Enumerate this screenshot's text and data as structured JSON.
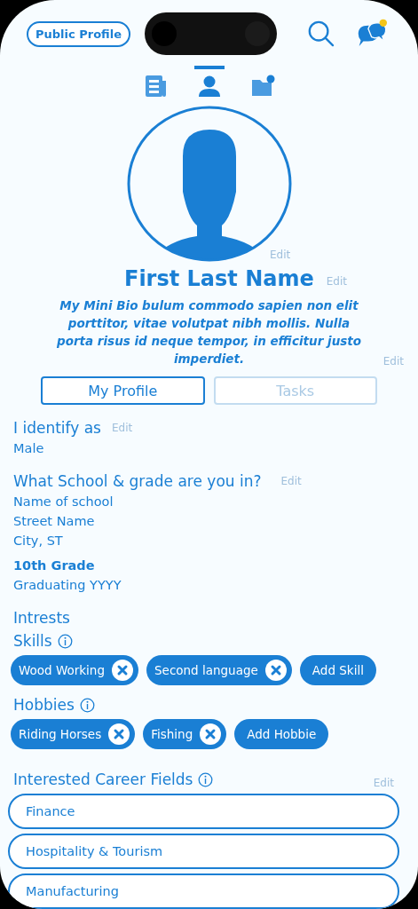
{
  "header": {
    "public_profile_button": "Public Profile",
    "notification_dot": true
  },
  "nav_tabs": [
    {
      "kind": "news",
      "selected": false
    },
    {
      "kind": "profile",
      "selected": true
    },
    {
      "kind": "folder",
      "selected": false
    }
  ],
  "avatar": {
    "edit": "Edit"
  },
  "name": {
    "text": "First Last Name",
    "edit": "Edit"
  },
  "bio": {
    "text": "My Mini Bio bulum commodo sapien non elit porttitor, vitae volutpat nibh mollis. Nulla porta risus id neque tempor, in efficitur justo imperdiet.",
    "edit": "Edit"
  },
  "profile_tabs": [
    {
      "label": "My Profile",
      "selected": true
    },
    {
      "label": "Tasks",
      "selected": false
    }
  ],
  "identity": {
    "title": "I identify as",
    "edit": "Edit",
    "value": "Male"
  },
  "school": {
    "title": "What School & grade are you in?",
    "edit": "Edit",
    "lines": [
      "Name of school",
      "Street Name",
      "City, ST"
    ],
    "grade": "10th Grade",
    "graduating": "Graduating YYYY"
  },
  "interests": {
    "title": "Intrests",
    "skills": {
      "title": "Skills",
      "chips": [
        {
          "kind": "tag",
          "label": "Wood Working"
        },
        {
          "kind": "tag",
          "label": "Second language"
        },
        {
          "kind": "add",
          "label": "Add Skill"
        }
      ]
    },
    "hobbies": {
      "title": "Hobbies",
      "chips": [
        {
          "kind": "tag",
          "label": "Riding Horses"
        },
        {
          "kind": "tag",
          "label": "Fishing"
        },
        {
          "kind": "add",
          "label": "Add Hobbie"
        }
      ]
    }
  },
  "careers": {
    "title": "Interested Career Fields",
    "edit": "Edit",
    "items": [
      "Finance",
      "Hospitality & Tourism",
      "Manufacturing"
    ]
  }
}
